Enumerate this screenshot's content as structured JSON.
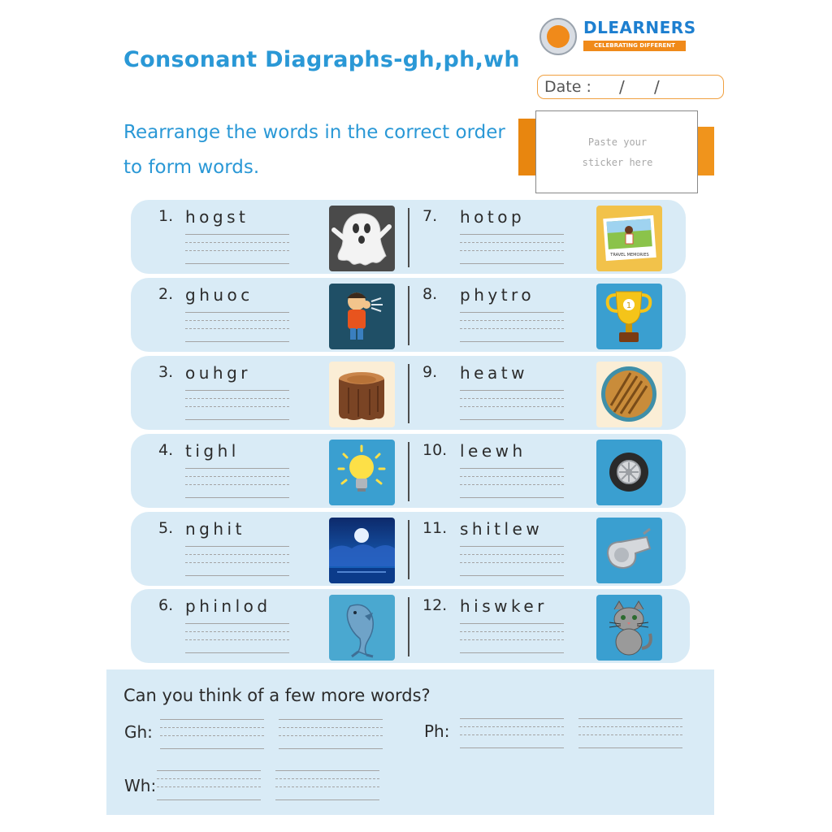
{
  "header": {
    "title": "Consonant Diagraphs-gh,ph,wh",
    "instruction": "Rearrange the words in the correct order to form words."
  },
  "logo": {
    "name": "DLEARNERS",
    "tagline": "CELEBRATING DIFFERENT LEARNERS",
    "brand_color": "#1d7fd0",
    "accent_color": "#f08a1a"
  },
  "date": {
    "label": "Date :",
    "slash": "/"
  },
  "sticker": {
    "line1": "Paste your",
    "line2": "sticker here"
  },
  "items": [
    {
      "num": "1.",
      "word": "hogst",
      "icon": "ghost-icon"
    },
    {
      "num": "2.",
      "word": "ghuoc",
      "icon": "boy-coughing-icon"
    },
    {
      "num": "3.",
      "word": "ouhgr",
      "icon": "tree-stump-icon"
    },
    {
      "num": "4.",
      "word": "tighl",
      "icon": "light-bulb-icon"
    },
    {
      "num": "5.",
      "word": "nghit",
      "icon": "night-sky-icon"
    },
    {
      "num": "6.",
      "word": "phinlod",
      "icon": "dolphin-icon"
    },
    {
      "num": "7.",
      "word": "hotop",
      "icon": "photo-icon",
      "caption": "TRAVEL MEMORIES"
    },
    {
      "num": "8.",
      "word": "phytro",
      "icon": "trophy-icon",
      "badge": "1"
    },
    {
      "num": "9.",
      "word": "heatw",
      "icon": "wheat-icon"
    },
    {
      "num": "10.",
      "word": "leewh",
      "icon": "wheel-icon"
    },
    {
      "num": "11.",
      "word": "shitlew",
      "icon": "whistle-icon"
    },
    {
      "num": "12.",
      "word": "hiswker",
      "icon": "whiskers-cat-icon"
    }
  ],
  "bottom": {
    "question": "Can you think of a few more words?",
    "gh_label": "Gh:",
    "ph_label": "Ph:",
    "wh_label": "Wh:"
  }
}
